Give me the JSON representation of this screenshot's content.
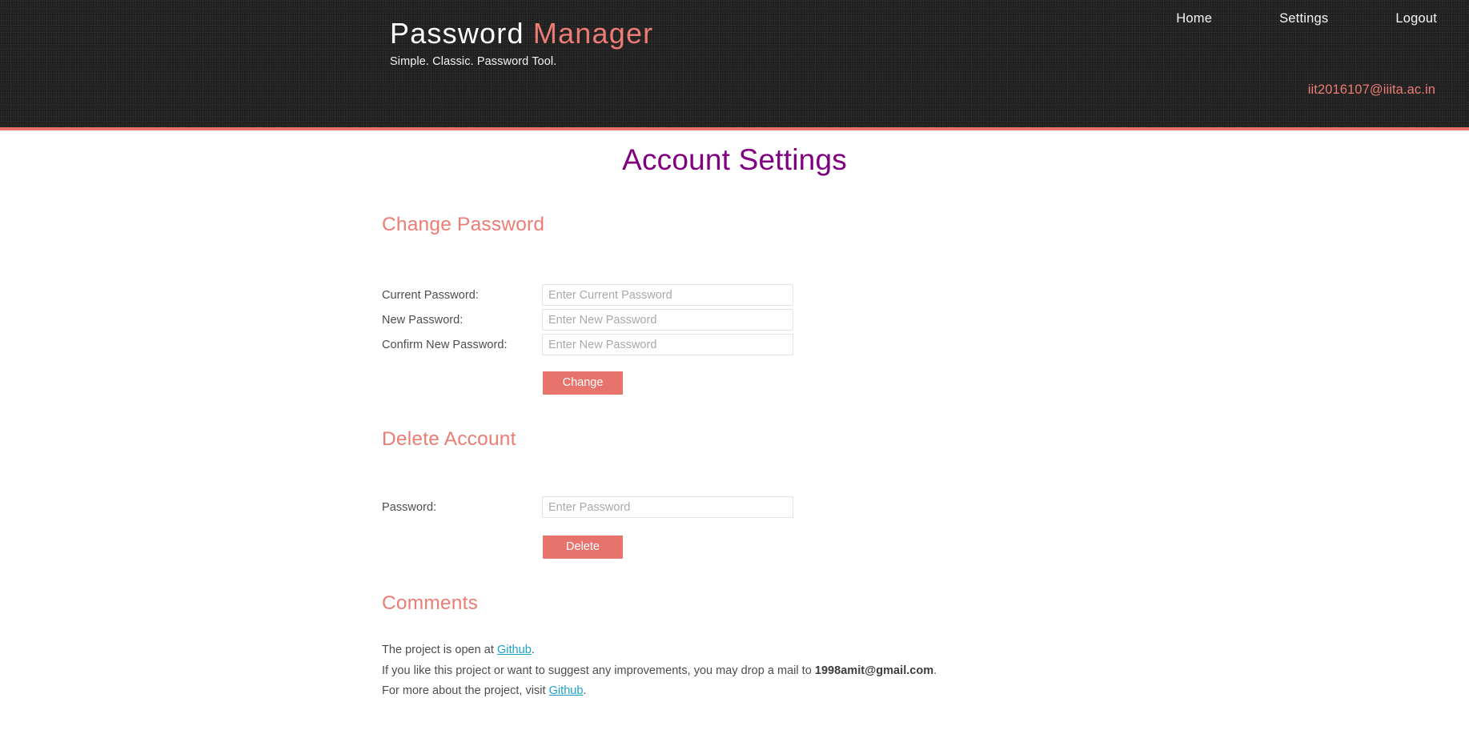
{
  "header": {
    "brand_word_1": "Password",
    "brand_word_2": "Manager",
    "tagline": "Simple. Classic. Password Tool.",
    "nav": [
      {
        "label": "Home",
        "name": "nav-home"
      },
      {
        "label": "Settings",
        "name": "nav-settings"
      },
      {
        "label": "Logout",
        "name": "nav-logout"
      }
    ],
    "user_email": "iit2016107@iiita.ac.in",
    "background_color": "#222222",
    "accent_color": "#e8736d"
  },
  "page": {
    "title": "Account Settings",
    "title_color": "#800080"
  },
  "change_password": {
    "heading": "Change Password",
    "fields": [
      {
        "label": "Current Password:",
        "placeholder": "Enter Current Password",
        "value": ""
      },
      {
        "label": "New Password:",
        "placeholder": "Enter New Password",
        "value": ""
      },
      {
        "label": "Confirm New Password:",
        "placeholder": "Enter New Password",
        "value": ""
      }
    ],
    "submit_label": "Change"
  },
  "delete_account": {
    "heading": "Delete Account",
    "field": {
      "label": "Password:",
      "placeholder": "Enter Password",
      "value": ""
    },
    "submit_label": "Delete"
  },
  "comments": {
    "heading": "Comments",
    "line_1": {
      "prefix": "The project is open at ",
      "link": "Github",
      "suffix": "."
    },
    "line_2": {
      "prefix": "If you like this project or want to suggest any improvements, you may drop a mail to ",
      "email": "1998amit@gmail.com",
      "suffix": "."
    },
    "line_3": {
      "prefix": "For more about the project, visit ",
      "link": "Github",
      "suffix": "."
    },
    "link_color": "#1aa3c8"
  }
}
